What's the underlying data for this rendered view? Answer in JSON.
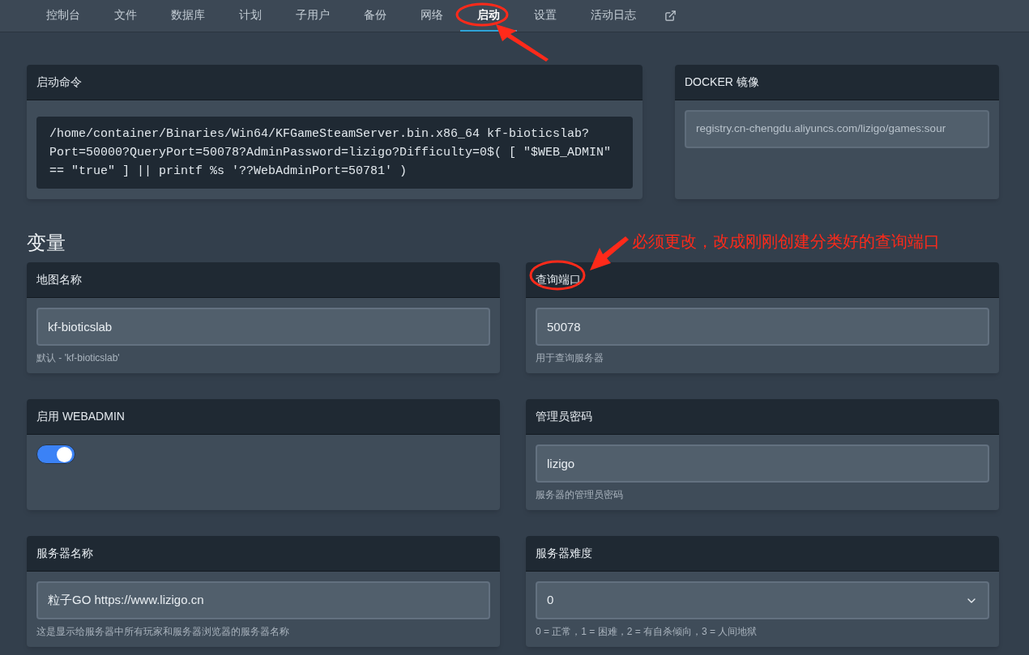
{
  "nav": {
    "tabs": [
      {
        "label": "控制台",
        "selected": false
      },
      {
        "label": "文件",
        "selected": false
      },
      {
        "label": "数据库",
        "selected": false
      },
      {
        "label": "计划",
        "selected": false
      },
      {
        "label": "子用户",
        "selected": false
      },
      {
        "label": "备份",
        "selected": false
      },
      {
        "label": "网络",
        "selected": false
      },
      {
        "label": "启动",
        "selected": true
      },
      {
        "label": "设置",
        "selected": false
      },
      {
        "label": "活动日志",
        "selected": false
      }
    ]
  },
  "startup_command": {
    "title": "启动命令",
    "command": "/home/container/Binaries/Win64/KFGameSteamServer.bin.x86_64 kf-bioticslab?\nPort=50000?QueryPort=50078?AdminPassword=lizigo?Difficulty=0$( [ \"$WEB_ADMIN\"\n== \"true\" ] || printf %s '??WebAdminPort=50781' )"
  },
  "docker_image": {
    "title": "DOCKER 镜像",
    "value": "registry.cn-chengdu.aliyuncs.com/lizigo/games:sour"
  },
  "variables": {
    "heading": "变量",
    "items": [
      {
        "kind": "text",
        "title": "地图名称",
        "value": "kf-bioticslab",
        "help": "默认 - 'kf-bioticslab'"
      },
      {
        "kind": "text",
        "title": "查询端口",
        "value": "50078",
        "help": "用于查询服务器"
      },
      {
        "kind": "toggle",
        "title": "启用 WEBADMIN",
        "on": true
      },
      {
        "kind": "text",
        "title": "管理员密码",
        "value": "lizigo",
        "help": "服务器的管理员密码"
      },
      {
        "kind": "text",
        "title": "服务器名称",
        "value": "粒子GO https://www.lizigo.cn",
        "help": "这是显示给服务器中所有玩家和服务器浏览器的服务器名称"
      },
      {
        "kind": "select",
        "title": "服务器难度",
        "value": "0",
        "help": "0 = 正常，1 = 困难，2 = 有自杀倾向，3 = 人间地狱"
      }
    ]
  },
  "annotation": {
    "text": "必须更改，改成刚刚创建分类好的查询端口"
  }
}
